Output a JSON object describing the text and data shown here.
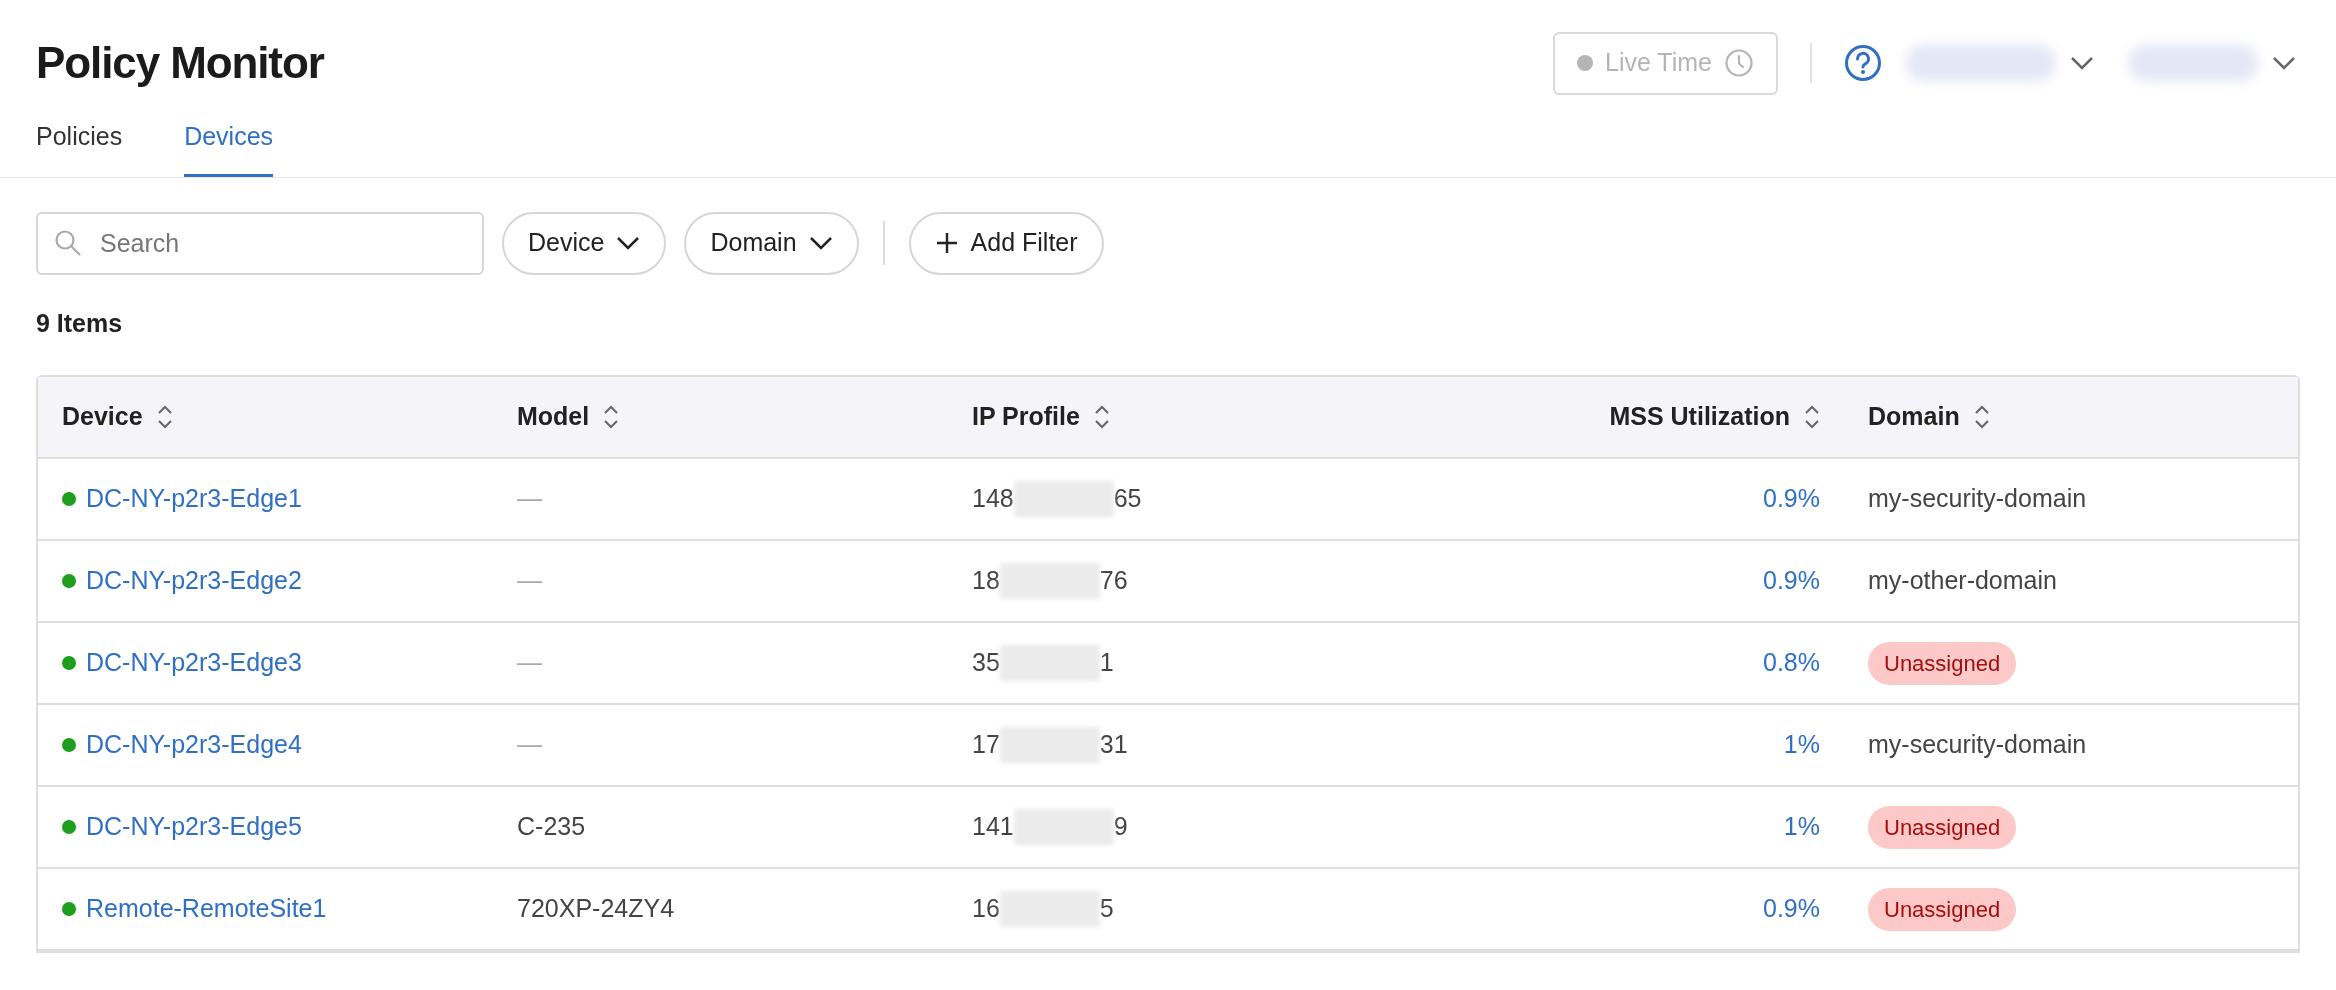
{
  "header": {
    "title": "Policy Monitor",
    "live_time": {
      "label": "Live Time",
      "disabled": true
    }
  },
  "tabs": [
    {
      "label": "Policies",
      "selected": false
    },
    {
      "label": "Devices",
      "selected": true
    }
  ],
  "toolbar": {
    "search": {
      "placeholder": "Search"
    },
    "filters": [
      "Device",
      "Domain"
    ],
    "add_filter": "Add Filter"
  },
  "item_count": "9 Items",
  "table": {
    "columns": [
      "Device",
      "Model",
      "IP Profile",
      "MSS Utilization",
      "Domain"
    ],
    "rows": [
      {
        "device": "DC-NY-p2r3-Edge1",
        "online": true,
        "model": "—",
        "ip_start": "148",
        "ip_end": "65",
        "mss": "0.9%",
        "domain": "my-security-domain",
        "assigned": true
      },
      {
        "device": "DC-NY-p2r3-Edge2",
        "online": true,
        "model": "—",
        "ip_start": "18",
        "ip_end": "76",
        "mss": "0.9%",
        "domain": "my-other-domain",
        "assigned": true
      },
      {
        "device": "DC-NY-p2r3-Edge3",
        "online": true,
        "model": "—",
        "ip_start": "35",
        "ip_end": "1",
        "mss": "0.8%",
        "domain": "Unassigned",
        "assigned": false
      },
      {
        "device": "DC-NY-p2r3-Edge4",
        "online": true,
        "model": "—",
        "ip_start": "17",
        "ip_end": "31",
        "mss": "1%",
        "domain": "my-security-domain",
        "assigned": true
      },
      {
        "device": "DC-NY-p2r3-Edge5",
        "online": true,
        "model": "C-235",
        "ip_start": "141",
        "ip_end": "9",
        "mss": "1%",
        "domain": "Unassigned",
        "assigned": false
      },
      {
        "device": "Remote-RemoteSite1",
        "online": true,
        "model": "720XP-24ZY4",
        "ip_start": "16",
        "ip_end": "5",
        "mss": "0.9%",
        "domain": "Unassigned",
        "assigned": false
      }
    ]
  }
}
